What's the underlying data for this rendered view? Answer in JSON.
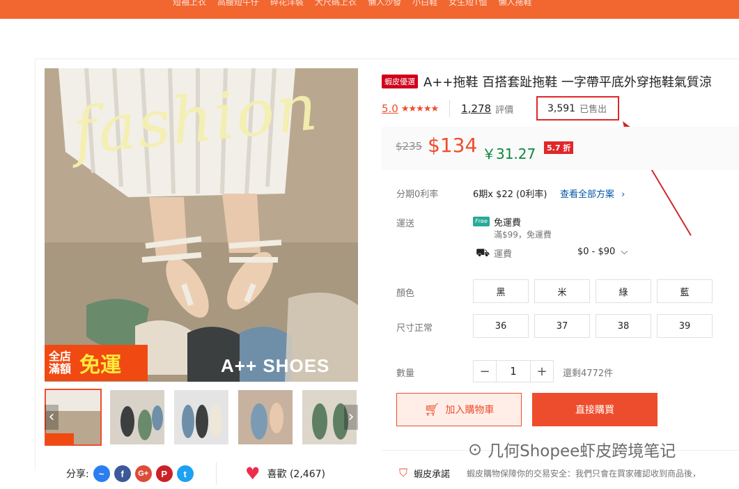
{
  "topbar": {
    "links": [
      "短袖上衣",
      "高腰短牛仔",
      "碎花洋裝",
      "大尺碼上衣",
      "懶人沙發",
      "小白鞋",
      "女生短T恤",
      "懶人拖鞋"
    ]
  },
  "gallery": {
    "main_image_text": "fashion",
    "promo_small": "全店滿額",
    "promo_big": "免運",
    "brand_mark": "A++ SHOES",
    "prev_arrow": "‹",
    "next_arrow": "›"
  },
  "share": {
    "label": "分享:",
    "icons": [
      "messenger-icon",
      "facebook-icon",
      "google-plus-icon",
      "pinterest-icon",
      "twitter-icon"
    ]
  },
  "like": {
    "label": "喜歡 (2,467)"
  },
  "product": {
    "mall_tag": "蝦皮優選",
    "title": "A++拖鞋 百搭套趾拖鞋 一字帶平底外穿拖鞋氣質涼",
    "rating": "5.0",
    "stars": "★★★★★",
    "reviews_count": "1,278",
    "reviews_label": "評價",
    "sold_count": "3,591",
    "sold_label": "已售出"
  },
  "price": {
    "original": "$235",
    "current": "$134",
    "rmb": "￥31.27",
    "discount": "5.7 折"
  },
  "installment": {
    "label": "分期0利率",
    "value": "6期x $22 (0利率)",
    "link": "查看全部方案"
  },
  "shipping": {
    "label": "運送",
    "badge": "Free",
    "free_title": "免運費",
    "free_sub": "滿$99，免運費",
    "fee_label": "運費",
    "fee_value": "$0 - $90"
  },
  "color": {
    "label": "顏色",
    "options": [
      "黑",
      "米",
      "綠",
      "藍"
    ]
  },
  "size": {
    "label": "尺寸正常",
    "options": [
      "36",
      "37",
      "38",
      "39"
    ]
  },
  "quantity": {
    "label": "數量",
    "minus": "−",
    "value": "1",
    "plus": "+",
    "stock": "還剩4772件"
  },
  "actions": {
    "add_to_cart": "加入購物車",
    "buy_now": "直接購買"
  },
  "guarantee": {
    "title": "蝦皮承諾",
    "desc": "蝦皮購物保障你的交易安全：我們只會在買家確認收到商品後，"
  },
  "watermark": {
    "text": "几何Shopee虾皮跨境笔记"
  },
  "colors": {
    "accent": "#ee4d2d",
    "topbar": "#f2662f",
    "rmb": "#08893a",
    "annotation": "#e0272a"
  }
}
